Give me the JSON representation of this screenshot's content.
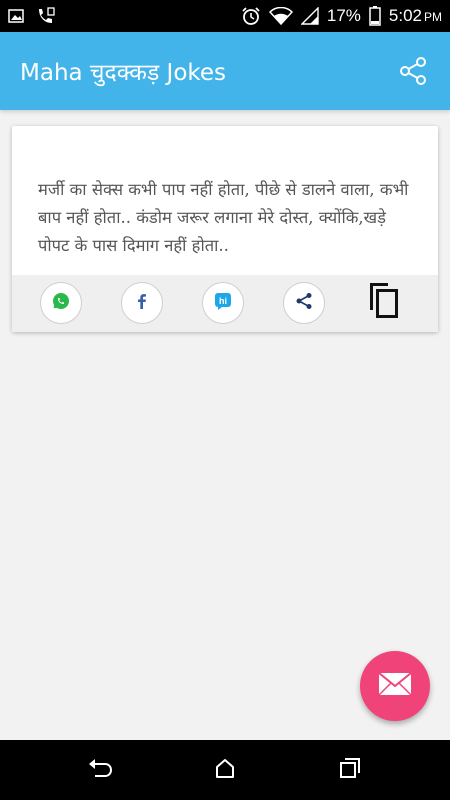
{
  "status_bar": {
    "battery_percent": "17%",
    "time": "5:02",
    "ampm": "PM",
    "icons": [
      "image-icon",
      "call-icon",
      "alarm-icon",
      "wifi-icon",
      "signal-icon",
      "battery-icon"
    ]
  },
  "app_bar": {
    "title": "Maha चुदक्कड़ Jokes",
    "share_icon": "share-icon"
  },
  "card": {
    "joke": "मर्जी का सेक्स कभी पाप नहीं होता,  पीछे से डालने वाला, कभी बाप नहीं होता..  कंडोम जरूर  लगाना  मेरे  दोस्त, क्योंकि,खड़े पोपट के पास दिमाग नहीं होता..",
    "actions": [
      "whatsapp-share",
      "facebook-share",
      "hike-share",
      "generic-share",
      "copy"
    ]
  },
  "fab": {
    "icon": "mail-icon",
    "color": "#f0437a"
  },
  "nav_bar": {
    "buttons": [
      "back",
      "home",
      "recents"
    ]
  },
  "colors": {
    "app_bar": "#42b4ea",
    "status_bar": "#000000",
    "background": "#f2f2f2"
  }
}
